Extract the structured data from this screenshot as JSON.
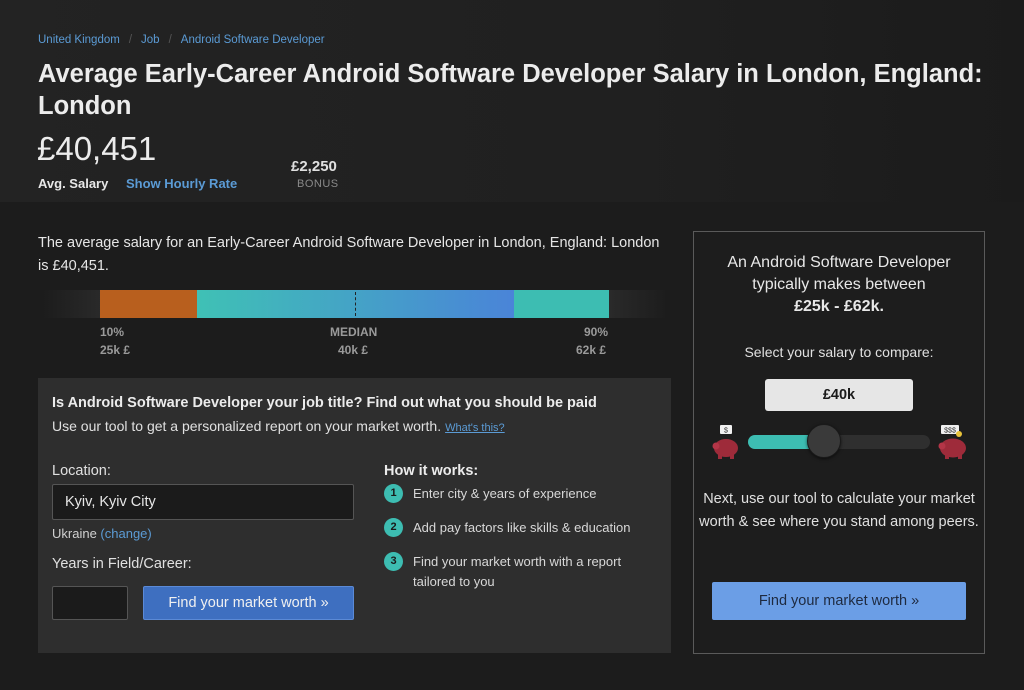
{
  "breadcrumb": [
    {
      "label": "United Kingdom"
    },
    {
      "label": "Job"
    },
    {
      "label": "Android Software Developer"
    }
  ],
  "breadcrumb_separator": "/",
  "header": {
    "title": "Average Early-Career Android Software Developer Salary in London, England: London",
    "avg_salary": "£40,451",
    "avg_label": "Avg. Salary",
    "hourly_link": "Show Hourly Rate",
    "bonus_amount": "£2,250",
    "bonus_label": "BONUS"
  },
  "summary": "The average salary for an Early-Career Android Software Developer in London, England: London is £40,451.",
  "distribution": {
    "p10_label": "10%",
    "p10_value": "25k £",
    "median_label": "MEDIAN",
    "median_value": "40k £",
    "p90_label": "90%",
    "p90_value": "62k £",
    "colors": {
      "low": "#b85f1e",
      "mid_start": "#3fc1b5",
      "mid_end": "#4a84d8",
      "high": "#3dbdb2",
      "fade": "#2a2a2a"
    }
  },
  "tool": {
    "question": "Is Android Software Developer your job title? Find out what you should be paid",
    "subtitle": "Use our tool to get a personalized report on your market worth.",
    "whats_this": "What's this?",
    "location_label": "Location:",
    "location_value": "Kyiv, Kyiv City",
    "country": "Ukraine",
    "change_link": "(change)",
    "years_label": "Years in Field/Career:",
    "years_value": "",
    "find_button": "Find your market worth »",
    "how_title": "How it works:",
    "steps": [
      {
        "num": "1",
        "text": "Enter city & years of experience"
      },
      {
        "num": "2",
        "text": "Add pay factors like skills & education"
      },
      {
        "num": "3",
        "text": "Find your market worth with a report tailored to you"
      }
    ]
  },
  "side": {
    "line1": "An Android Software Developer",
    "line2": "typically makes between",
    "range": "£25k - £62k.",
    "select_label": "Select your salary to compare:",
    "salary_value": "£40k",
    "slider_level": 0.42,
    "pig_low_tag": "$",
    "pig_high_tag": "$$$",
    "next_text": "Next, use our tool to calculate your market worth & see where you stand among peers.",
    "button": "Find your market worth »",
    "accent": "#3dbdb2"
  }
}
